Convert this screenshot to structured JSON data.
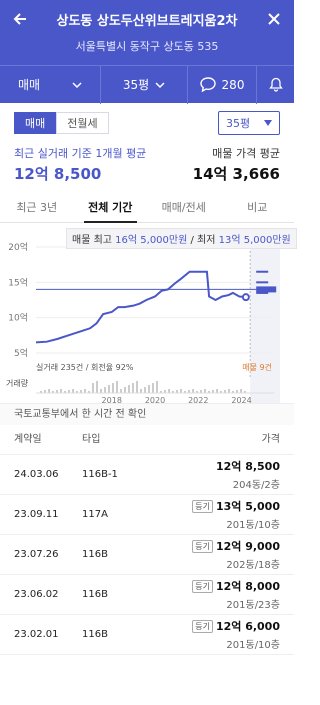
{
  "header": {
    "title": "상도동 상도두산위브트레지움2차",
    "address": "서울특별시 동작구 상도동 535",
    "trade_type": "매매",
    "size": "35평",
    "comment_count": "280"
  },
  "filters": {
    "seg": [
      "매매",
      "전월세"
    ],
    "active_seg": 0,
    "size_select": "35평"
  },
  "summary": {
    "left_label": "최근 실거래 기준 1개월 평균",
    "left_value": "12억 8,500",
    "right_label": "매물 가격 평균",
    "right_value": "14억 3,666"
  },
  "tabs": [
    "최근 3년",
    "전체 기간",
    "매매/전세",
    "비교"
  ],
  "active_tab": 1,
  "tooltip": {
    "p1": "매물 최고 ",
    "max": "16억 5,000만원",
    "p2": " / 최저 ",
    "min": "13억 5,000만원"
  },
  "chart_data": {
    "type": "line",
    "y_ticks": [
      "20억",
      "15억",
      "10억",
      "5억"
    ],
    "ylim": [
      5,
      20
    ],
    "x_ticks": [
      "2018",
      "2020",
      "2022",
      "2024"
    ],
    "series": [
      {
        "x": [
          2014.5,
          2015.0,
          2015.5,
          2016.0,
          2016.5,
          2017.0,
          2017.3,
          2017.6,
          2018.0,
          2018.3,
          2018.6,
          2019.0,
          2019.3,
          2019.6,
          2020.0,
          2020.3,
          2020.6,
          2020.9,
          2021.2,
          2021.6,
          2022.0,
          2022.2,
          2022.4,
          2022.5,
          2022.8,
          2023.1,
          2023.4,
          2023.6,
          2023.9,
          2024.2
        ],
        "values": [
          6.5,
          6.6,
          7.0,
          7.5,
          8.0,
          8.5,
          9.2,
          10.5,
          10.8,
          11.5,
          11.5,
          11.7,
          12.0,
          12.5,
          13.0,
          13.8,
          14.0,
          14.8,
          15.5,
          16.5,
          16.5,
          16.5,
          16.5,
          13.0,
          12.5,
          13.0,
          13.2,
          13.5,
          13.0,
          12.9
        ]
      }
    ],
    "reference_line": 14.0,
    "listing_ticks": [
      16.5,
      15.0,
      14.0,
      13.5
    ],
    "bottom_left": "실거래 235건 / 회전율 92%",
    "bottom_right": "매물 9건",
    "volume_label": "거래량"
  },
  "note": "국토교통부에서 한 시간 전 확인",
  "table": {
    "headers": [
      "계약일",
      "타입",
      "가격"
    ],
    "rows": [
      {
        "date": "24.03.06",
        "type": "116B-1",
        "badge": "",
        "price": "12억 8,500",
        "floor": "204동/2층"
      },
      {
        "date": "23.09.11",
        "type": "117A",
        "badge": "등기",
        "price": "13억 5,000",
        "floor": "201동/10층"
      },
      {
        "date": "23.07.26",
        "type": "116B",
        "badge": "등기",
        "price": "12억 9,000",
        "floor": "202동/18층"
      },
      {
        "date": "23.06.02",
        "type": "116B",
        "badge": "등기",
        "price": "12억 8,000",
        "floor": "201동/23층"
      },
      {
        "date": "23.02.01",
        "type": "116B",
        "badge": "등기",
        "price": "12억 6,000",
        "floor": "201동/10층"
      }
    ]
  },
  "colors": {
    "accent": "#4a57c9",
    "listing": "#e07a2a"
  }
}
